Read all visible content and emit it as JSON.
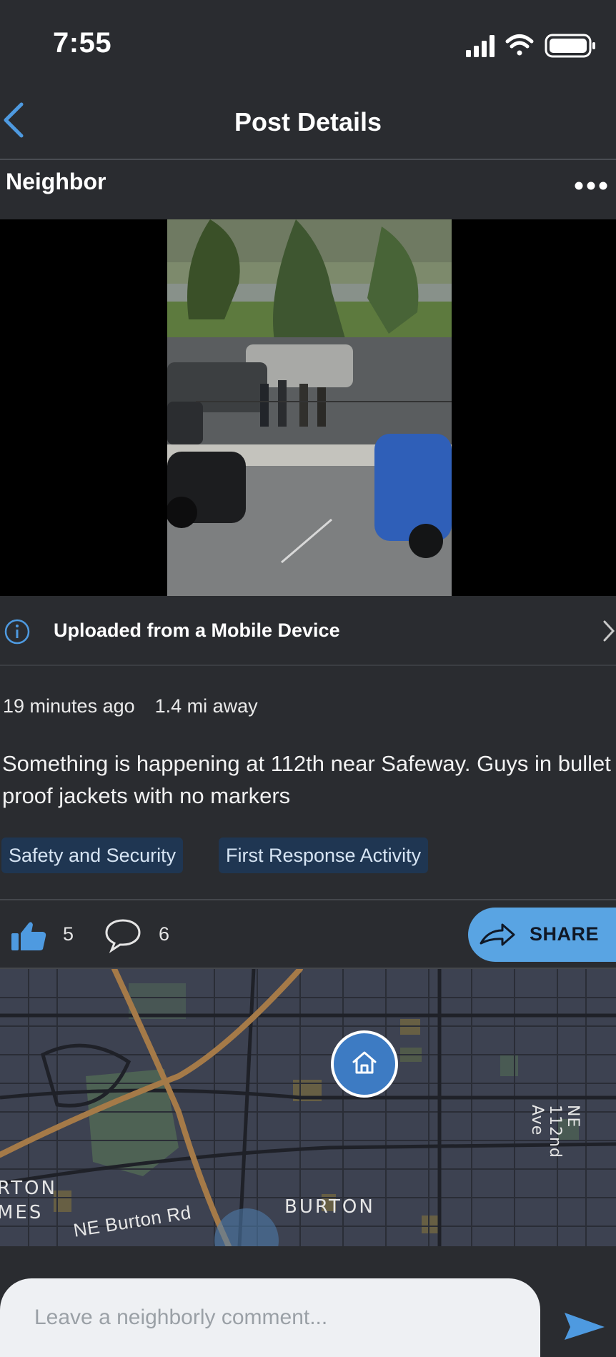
{
  "status_bar": {
    "time": "7:55"
  },
  "nav": {
    "title": "Post Details"
  },
  "post": {
    "author": "Neighbor",
    "upload_source": "Uploaded from a Mobile Device",
    "time_ago": "19 minutes ago",
    "distance": "1.4 mi away",
    "text": "Something is happening at 112th near Safeway. Guys in bullet proof jackets with no markers",
    "tags": [
      "Safety and Security",
      "First Response Activity"
    ],
    "likes": "5",
    "comments": "6",
    "share_label": "SHARE"
  },
  "map": {
    "labels": {
      "district_1": "RTON",
      "district_2": "MES",
      "road": "NE Burton Rd",
      "area": "BURTON",
      "avenue": "NE 112nd Ave"
    }
  },
  "comment": {
    "placeholder": "Leave a neighborly comment..."
  },
  "colors": {
    "background": "#2a2c30",
    "accent": "#59a4e3",
    "tag_bg": "#1f3652",
    "map_bg": "#3d4251"
  }
}
